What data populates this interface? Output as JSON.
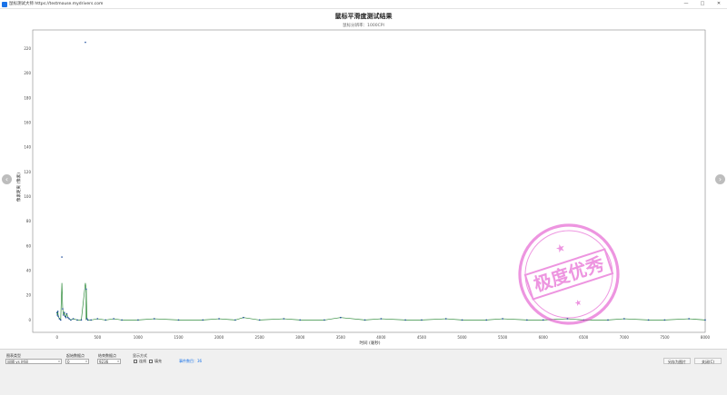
{
  "window": {
    "title": "鼠标测试大师 https://testmouse.mydrivers.com",
    "min_glyph": "—",
    "max_glyph": "□",
    "close_glyph": "✕"
  },
  "nav": {
    "prev_glyph": "‹",
    "next_glyph": "›"
  },
  "chart_data": {
    "type": "scatter",
    "title": "鼠标平滑度测试结果",
    "subtitle": "鼠标分辨率：1000CPI",
    "xlabel": "时间 (毫秒)",
    "ylabel": "像素距离 (像素)",
    "xlim": [
      -300,
      8000
    ],
    "ylim": [
      -10,
      235
    ],
    "x_ticks": [
      0,
      500,
      1000,
      1500,
      2000,
      2500,
      3000,
      3500,
      4000,
      4500,
      5000,
      5500,
      6000,
      6500,
      7000,
      7500,
      8000
    ],
    "y_ticks": [
      0,
      20,
      40,
      60,
      80,
      100,
      120,
      140,
      160,
      180,
      200,
      220
    ],
    "grid": true,
    "line_color": "#2e8b3a",
    "point_color": "#1f4e9c",
    "series": [
      {
        "values_xy": [
          [
            0,
            6
          ],
          [
            5,
            4
          ],
          [
            10,
            7
          ],
          [
            15,
            3
          ],
          [
            30,
            1
          ],
          [
            45,
            0
          ],
          [
            60,
            51
          ],
          [
            70,
            9
          ],
          [
            80,
            4
          ],
          [
            90,
            6
          ],
          [
            100,
            3
          ],
          [
            110,
            2
          ],
          [
            120,
            5
          ],
          [
            135,
            2
          ],
          [
            150,
            1
          ],
          [
            170,
            0
          ],
          [
            200,
            1
          ],
          [
            250,
            0
          ],
          [
            300,
            0
          ],
          [
            350,
            225
          ],
          [
            360,
            25
          ],
          [
            370,
            1
          ],
          [
            380,
            0
          ],
          [
            420,
            0
          ],
          [
            500,
            1
          ],
          [
            600,
            0
          ],
          [
            700,
            1
          ],
          [
            800,
            0
          ],
          [
            1000,
            0
          ],
          [
            1200,
            1
          ],
          [
            1500,
            0
          ],
          [
            1800,
            0
          ],
          [
            2000,
            1
          ],
          [
            2200,
            0
          ],
          [
            2300,
            2
          ],
          [
            2500,
            0
          ],
          [
            2800,
            1
          ],
          [
            3000,
            0
          ],
          [
            3300,
            0
          ],
          [
            3500,
            2
          ],
          [
            3800,
            0
          ],
          [
            4000,
            1
          ],
          [
            4300,
            0
          ],
          [
            4500,
            0
          ],
          [
            4800,
            1
          ],
          [
            5000,
            0
          ],
          [
            5300,
            0
          ],
          [
            5500,
            1
          ],
          [
            5800,
            0
          ],
          [
            6000,
            0
          ],
          [
            6300,
            1
          ],
          [
            6500,
            0
          ],
          [
            6800,
            0
          ],
          [
            7000,
            1
          ],
          [
            7300,
            0
          ],
          [
            7500,
            0
          ],
          [
            7800,
            1
          ],
          [
            8000,
            0
          ]
        ]
      }
    ]
  },
  "stamp": {
    "main_text": "极度优秀",
    "color": "#e040c8"
  },
  "controls": {
    "chart_type_label": "图表类型",
    "chart_type_value": "间隔 vs 时间",
    "start_point_label": "起始数据点",
    "start_point_value": "0",
    "end_point_label": "结束数据点",
    "end_point_value": "9236",
    "display_label": "显示方式",
    "line_label": "连线",
    "bar_label": "填充",
    "sample_rate_text": "事件数目：36",
    "save_image_label": "另存为图片",
    "close_label": "关闭(C)"
  }
}
